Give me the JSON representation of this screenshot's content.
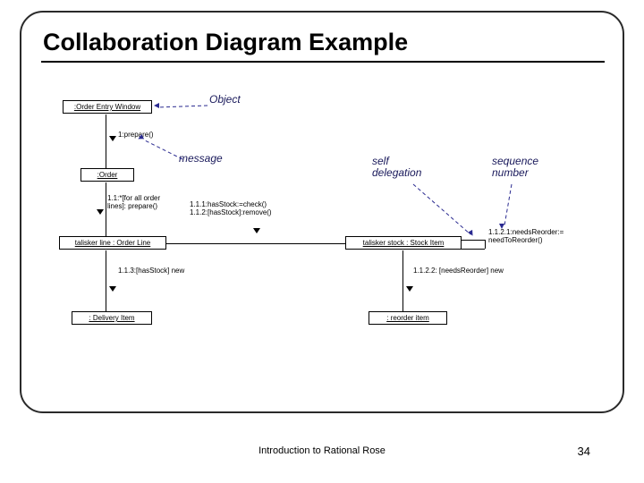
{
  "slide": {
    "title": "Collaboration Diagram Example",
    "footer": "Introduction to Rational Rose",
    "page_number": "34"
  },
  "callouts": {
    "object": "Object",
    "message": "message",
    "self_delegation": "self\ndelegation",
    "sequence_number": "sequence\nnumber"
  },
  "objects": {
    "order_entry_window": ":Order Entry Window",
    "order": ":Order",
    "order_line": "talisker line : Order Line",
    "stock_item": "talisker stock : Stock Item",
    "delivery_item": ": Delivery Item",
    "reorder_item": ": reorder item"
  },
  "messages": {
    "prepare": "1:prepare()",
    "for_all": "1.1:*[for all order\nlines]: prepare()",
    "check_remove": "1.1.1:hasStock:=check()\n1.1.2:[hasStock]:remove()",
    "new_delivery": "1.1.3:[hasStock] new",
    "needs_reorder": "1.1.2.1:needsReorder:=\nneedToReorder()",
    "new_reorder": "1.1.2.2: [needsReorder] new"
  }
}
